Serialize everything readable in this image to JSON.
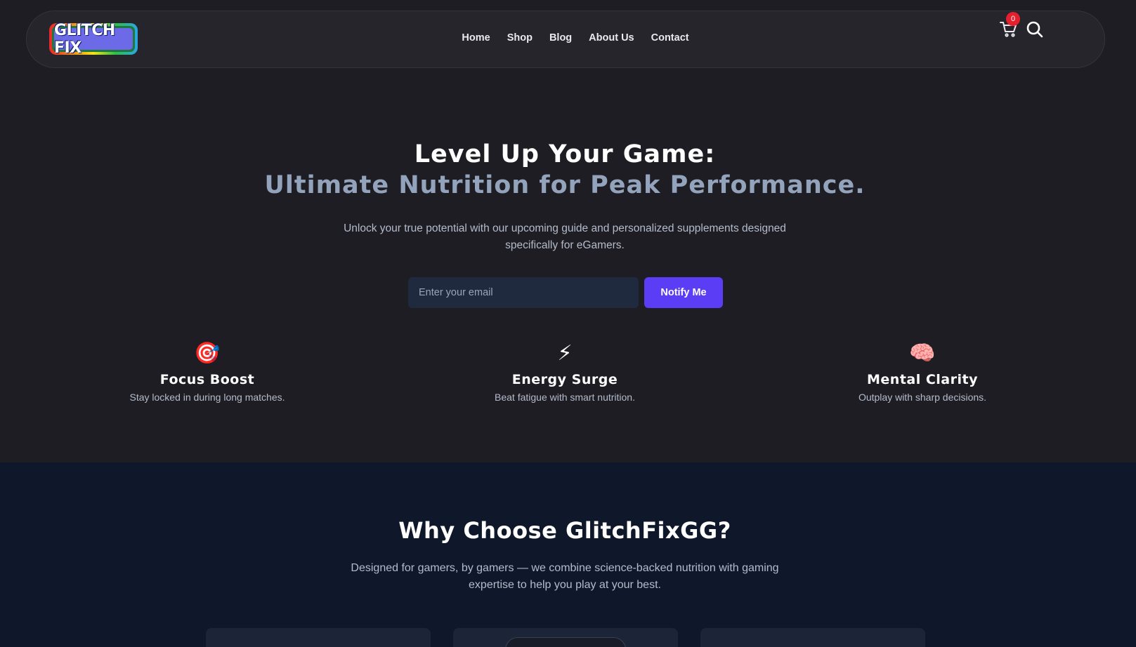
{
  "header": {
    "logo_text": "GLITCH FIX",
    "nav": [
      "Home",
      "Shop",
      "Blog",
      "About Us",
      "Contact"
    ],
    "cart_count": "0",
    "cart_icon": "cart-icon",
    "search_icon": "search-icon"
  },
  "hero": {
    "title_line1": "Level Up Your Game:",
    "title_line2": "Ultimate Nutrition for Peak Performance.",
    "subtitle": "Unlock your true potential with our upcoming guide and personalized supplements designed specifically for eGamers.",
    "email_placeholder": "Enter your email",
    "notify_label": "Notify Me"
  },
  "features": [
    {
      "icon": "🎯",
      "icon_name": "target-icon",
      "title": "Focus Boost",
      "desc": "Stay locked in during long matches."
    },
    {
      "icon": "⚡",
      "icon_name": "lightning-icon",
      "title": "Energy Surge",
      "desc": "Beat fatigue with smart nutrition."
    },
    {
      "icon": "🧠",
      "icon_name": "brain-icon",
      "title": "Mental Clarity",
      "desc": "Outplay with sharp decisions."
    }
  ],
  "why": {
    "title": "Why Choose GlitchFixGG?",
    "subtitle": "Designed for gamers, by gamers — we combine science-backed nutrition with gaming expertise to help you play at your best."
  },
  "colors": {
    "background": "#1e1d23",
    "navbar": "#26252b",
    "accent": "#5a3df5",
    "title_accent": "#93a3bb",
    "section2_bg": "#0f172a",
    "badge": "#e51f2d"
  }
}
